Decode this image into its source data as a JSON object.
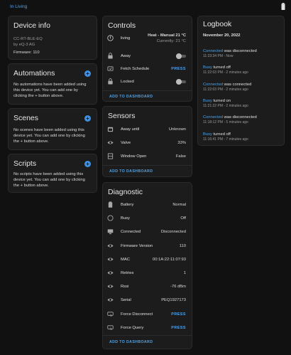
{
  "breadcrumb": "In Living",
  "device_info": {
    "title": "Device info",
    "model": "CC-RT-BLE-EQ",
    "manufacturer": "by eQ-3 AG",
    "firmware": "Firmware: 110"
  },
  "automations": {
    "title": "Automations",
    "desc": "No automations have been added using this device yet. You can add one by clicking the + button above."
  },
  "scenes": {
    "title": "Scenes",
    "desc": "No scenes have been added using this device yet. You can add one by clicking the + button above."
  },
  "scripts": {
    "title": "Scripts",
    "desc": "No scripts have been added using this device yet. You can add one by clicking the + button above."
  },
  "controls": {
    "title": "Controls",
    "climate": {
      "label": "living",
      "mode": "Heat - Manual 21 °C",
      "current": "Currently: 21 °C"
    },
    "rows": [
      {
        "label": "Away",
        "type": "toggle",
        "on": false
      },
      {
        "label": "Fetch Schedule",
        "type": "press",
        "action": "PRESS"
      },
      {
        "label": "Locked",
        "type": "toggle",
        "on": false
      }
    ],
    "add_to_dashboard": "ADD TO DASHBOARD"
  },
  "sensors": {
    "title": "Sensors",
    "rows": [
      {
        "label": "Away until",
        "value": "Unknown"
      },
      {
        "label": "Valve",
        "value": "33%"
      },
      {
        "label": "Window Open",
        "value": "False"
      }
    ],
    "add_to_dashboard": "ADD TO DASHBOARD"
  },
  "diagnostic": {
    "title": "Diagnostic",
    "rows": [
      {
        "label": "Battery",
        "value": "Normal",
        "icon": "battery-icon"
      },
      {
        "label": "Busy",
        "value": "Off",
        "icon": "circle-outline-icon"
      },
      {
        "label": "Connected",
        "value": "Disconnected",
        "icon": "monitor-icon"
      },
      {
        "label": "Firmware Version",
        "value": "110",
        "icon": "eye-icon"
      },
      {
        "label": "MAC",
        "value": "00:1A:22:11:07:93",
        "icon": "eye-icon"
      },
      {
        "label": "Retries",
        "value": "1",
        "icon": "eye-icon"
      },
      {
        "label": "Rssi",
        "value": "-76 dBm",
        "icon": "eye-icon"
      },
      {
        "label": "Serial",
        "value": "PEQ1927173",
        "icon": "eye-icon"
      },
      {
        "label": "Force Disconnect",
        "value": "PRESS",
        "icon": "button-icon"
      },
      {
        "label": "Force Query",
        "value": "PRESS",
        "icon": "button-icon"
      }
    ],
    "add_to_dashboard": "ADD TO DASHBOARD"
  },
  "logbook": {
    "title": "Logbook",
    "date": "November 20, 2022",
    "entries": [
      {
        "entity": "Connected",
        "text": " was disconnected",
        "time": "11:23:34 PM - Now"
      },
      {
        "entity": "Busy",
        "text": " turned off",
        "time": "11:22:03 PM - 2 minutes ago"
      },
      {
        "entity": "Connected",
        "text": " was connected",
        "time": "11:22:03 PM - 2 minutes ago"
      },
      {
        "entity": "Busy",
        "text": " turned on",
        "time": "11:21:22 PM - 2 minutes ago"
      },
      {
        "entity": "Connected",
        "text": " was disconnected",
        "time": "11:18:12 PM - 5 minutes ago"
      },
      {
        "entity": "Busy",
        "text": " turned off",
        "time": "11:16:41 PM - 7 minutes ago"
      }
    ]
  },
  "colors": {
    "accent": "#4ea3ea",
    "card": "#1c1c1c",
    "background": "#111111",
    "icon": "#a9a9a9"
  }
}
